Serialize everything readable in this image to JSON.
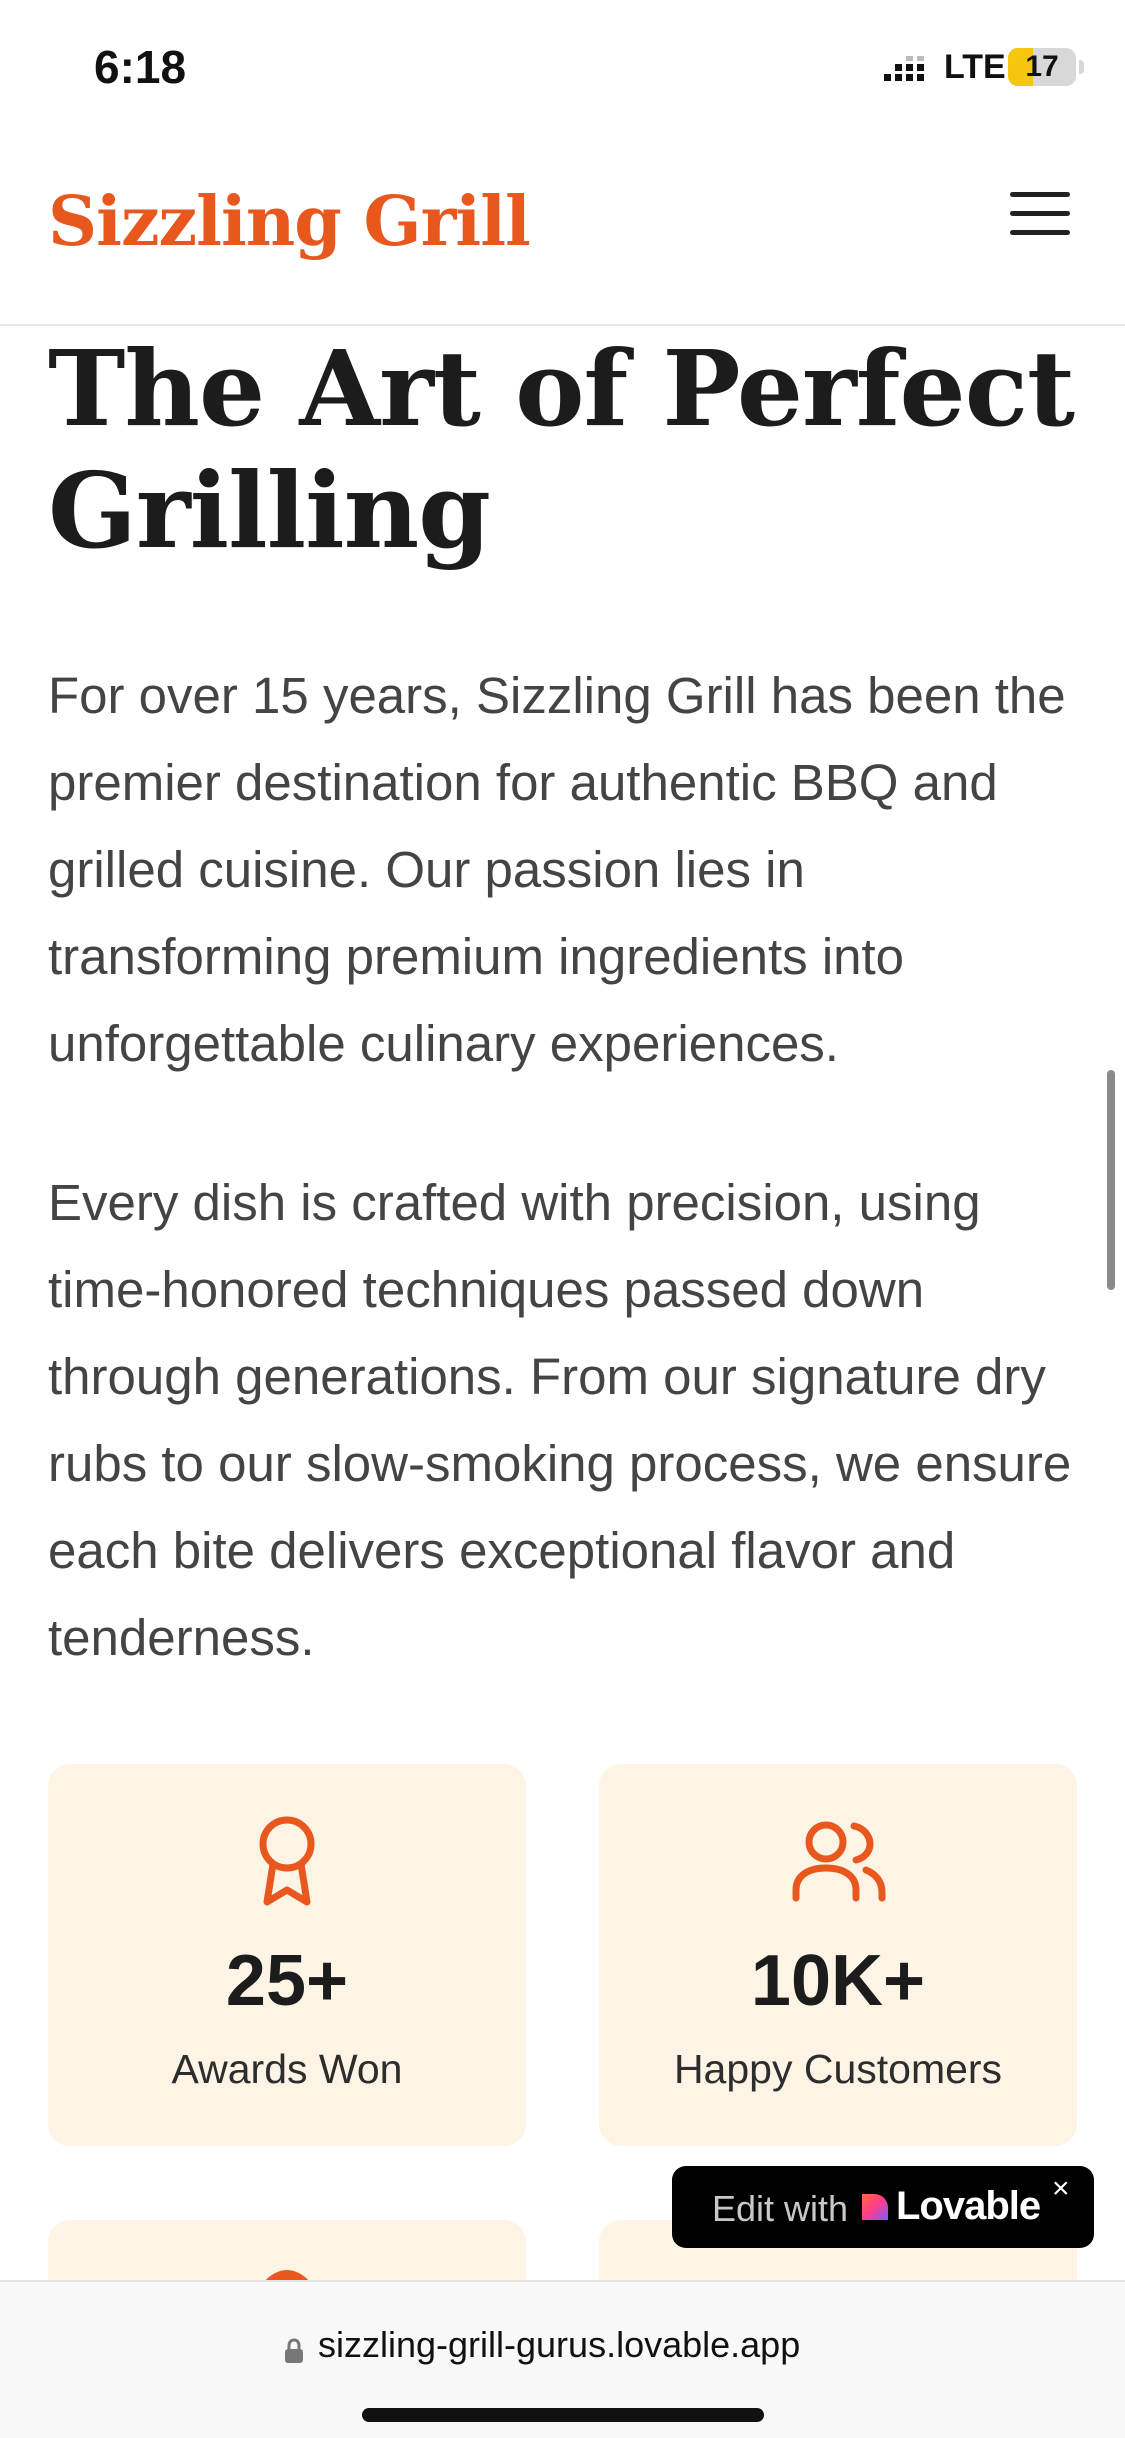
{
  "status_bar": {
    "time": "6:18",
    "network": "LTE",
    "battery_level": "17",
    "battery_fraction": 0.17,
    "signal_icon": "signal-bars-icon"
  },
  "header": {
    "brand": "Sizzling Grill",
    "menu_icon": "hamburger-menu-icon"
  },
  "main": {
    "title_line1": "The Art of Perfect",
    "title_line2": "Grilling",
    "paragraph1": "For over 15 years, Sizzling Grill has been the premier destination for authentic BBQ and grilled cuisine. Our passion lies in transforming premium ingredients into unforgettable culinary experiences.",
    "paragraph2": "Every dish is crafted with precision, using time-honored techniques passed down through generations. From our signature dry rubs to our slow-smoking process, we ensure each bite delivers exceptional flavor and tenderness."
  },
  "stats": [
    {
      "icon": "award-ribbon-icon",
      "value": "25+",
      "label": "Awards Won"
    },
    {
      "icon": "users-icon",
      "value": "10K+",
      "label": "Happy Customers"
    }
  ],
  "badge": {
    "edit_text": "Edit with",
    "brand": "Lovable",
    "close": "×"
  },
  "browser": {
    "url": "sizzling-grill-gurus.lovable.app"
  },
  "colors": {
    "accent": "#e8581e",
    "card_bg": "#fdf4e6",
    "text": "#444444",
    "title": "#1c1c1c"
  }
}
